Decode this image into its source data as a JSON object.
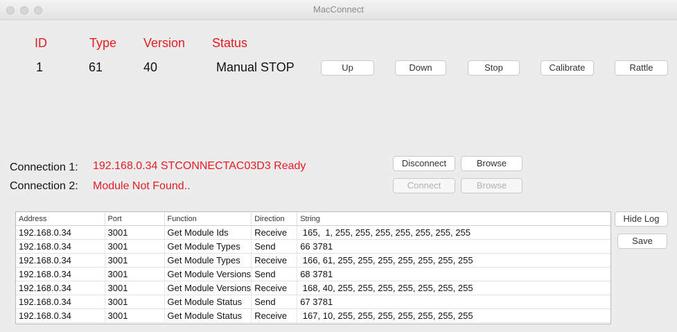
{
  "window": {
    "title": "MacConnect"
  },
  "module": {
    "headers": {
      "id": "ID",
      "type": "Type",
      "version": "Version",
      "status": "Status"
    },
    "values": {
      "id": "1",
      "type": "61",
      "version": "40",
      "status": "Manual STOP"
    },
    "buttons": {
      "up": "Up",
      "down": "Down",
      "stop": "Stop",
      "calibrate": "Calibrate",
      "rattle": "Rattle"
    }
  },
  "connections": [
    {
      "label": "Connection 1:",
      "value": "192.168.0.34 STCONNECTAC03D3 Ready",
      "action": "Disconnect",
      "browse": "Browse",
      "enabled": true
    },
    {
      "label": "Connection 2:",
      "value": "Module Not Found..",
      "action": "Connect",
      "browse": "Browse",
      "enabled": false
    }
  ],
  "log": {
    "columns": [
      "Address",
      "Port",
      "Function",
      "Direction",
      "String"
    ],
    "rows": [
      [
        "192.168.0.34",
        "3001",
        "Get Module Ids",
        "Receive",
        " 165,  1, 255, 255, 255, 255, 255, 255, 255"
      ],
      [
        "192.168.0.34",
        "3001",
        "Get Module Types",
        "Send",
        "66 3781"
      ],
      [
        "192.168.0.34",
        "3001",
        "Get Module Types",
        "Receive",
        " 166, 61, 255, 255, 255, 255, 255, 255, 255"
      ],
      [
        "192.168.0.34",
        "3001",
        "Get Module Versions",
        "Send",
        "68 3781"
      ],
      [
        "192.168.0.34",
        "3001",
        "Get Module Versions",
        "Receive",
        " 168, 40, 255, 255, 255, 255, 255, 255, 255"
      ],
      [
        "192.168.0.34",
        "3001",
        "Get Module Status",
        "Send",
        "67 3781"
      ],
      [
        "192.168.0.34",
        "3001",
        "Get Module Status",
        "Receive",
        " 167, 10, 255, 255, 255, 255, 255, 255, 255"
      ]
    ],
    "hide_label": "Hide Log",
    "save_label": "Save"
  }
}
